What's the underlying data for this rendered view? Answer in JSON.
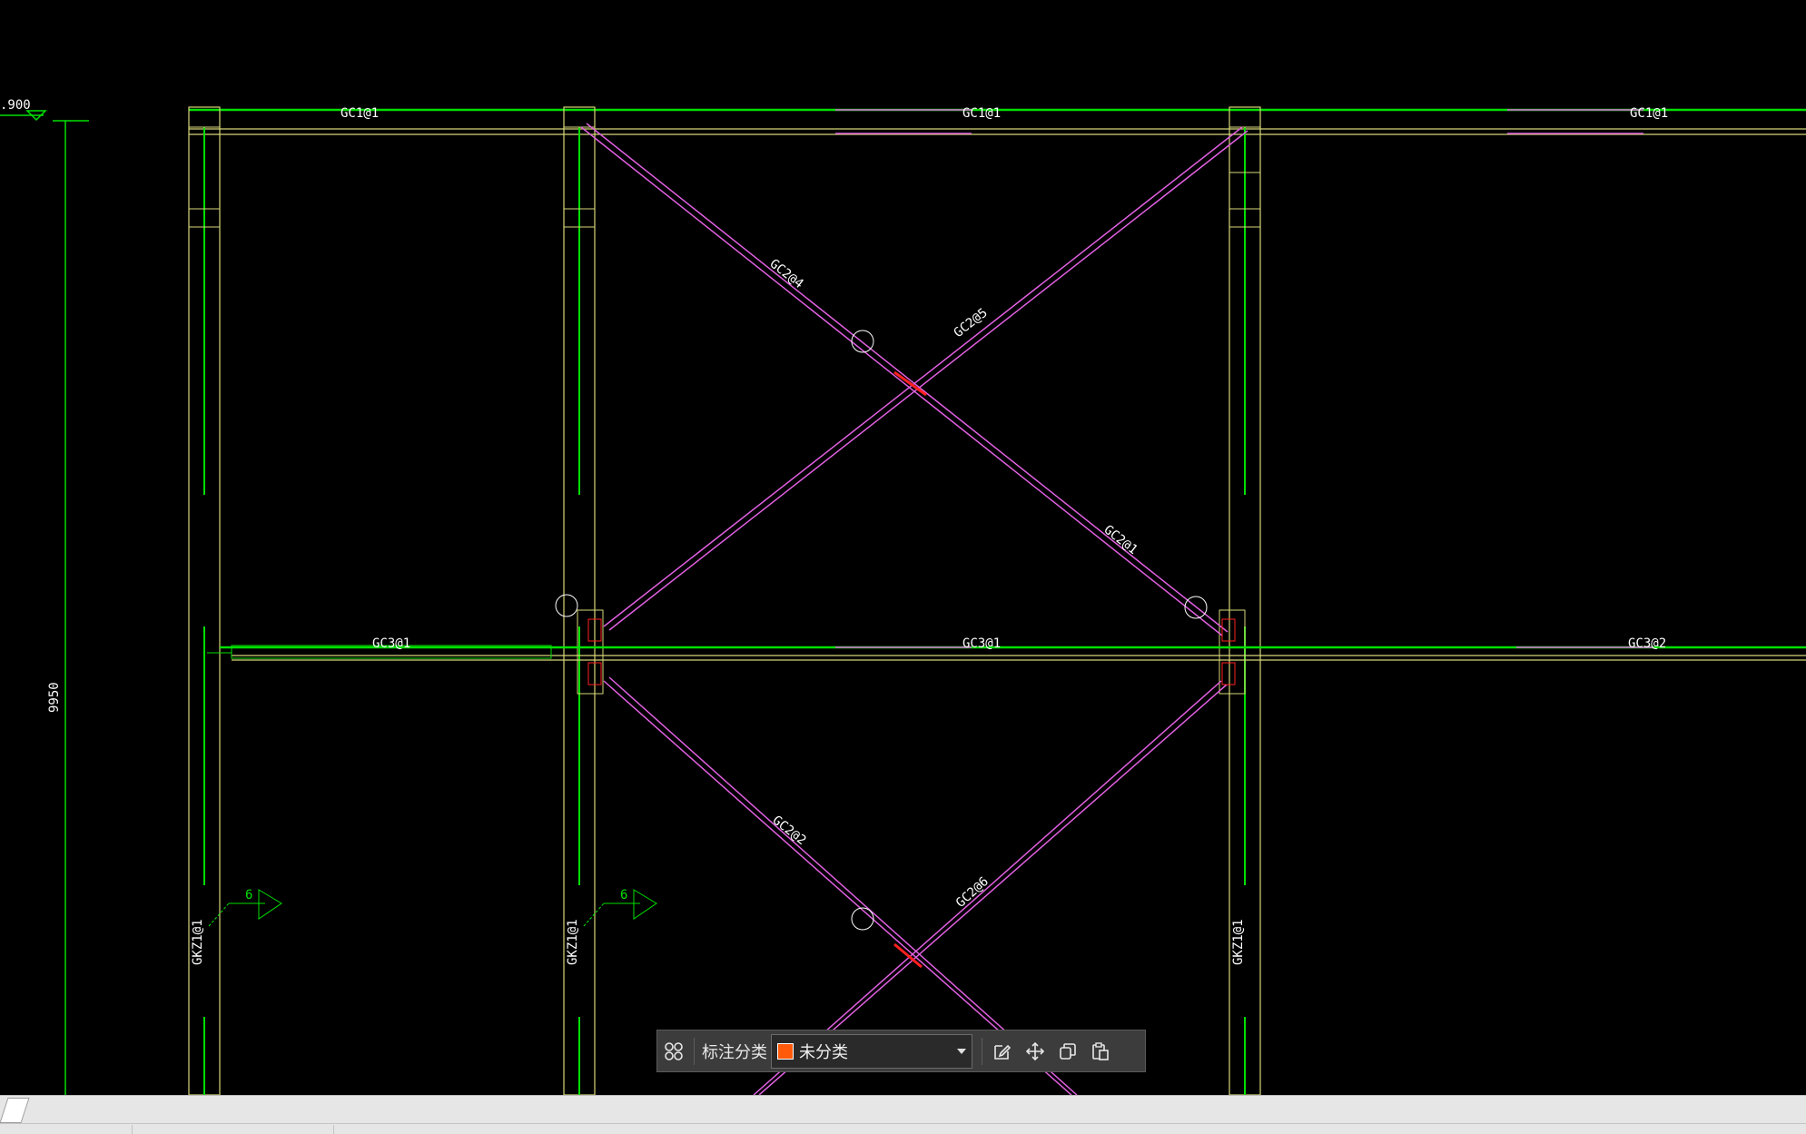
{
  "drawing": {
    "elevation_label": ".900",
    "height_dim": "9950",
    "weld_symbol_value": "6",
    "beam_labels": [
      "GC1@1",
      "GC1@1",
      "GC1@1"
    ],
    "strut_labels": [
      "GC3@1",
      "GC3@1",
      "GC3@2"
    ],
    "brace_labels": [
      "GC2@4",
      "GC2@5",
      "GC2@1",
      "GC2@2",
      "GC2@6"
    ],
    "column_labels": [
      "GKZ1@1",
      "GKZ1@1",
      "GKZ1@1"
    ],
    "colors": {
      "background": "#000000",
      "green": "#00e000",
      "yellow": "#d7d778",
      "magenta": "#e060e0",
      "white": "#ffffff",
      "red": "#ff2020"
    }
  },
  "toolbar": {
    "grid_icon": "grid-icon",
    "category_label": "标注分类",
    "category_value": "未分类",
    "category_color": "#ff5a0a",
    "edit_icon": "edit-icon",
    "move_icon": "move-icon",
    "copy_icon": "copy-icon",
    "paste_icon": "paste-icon"
  }
}
